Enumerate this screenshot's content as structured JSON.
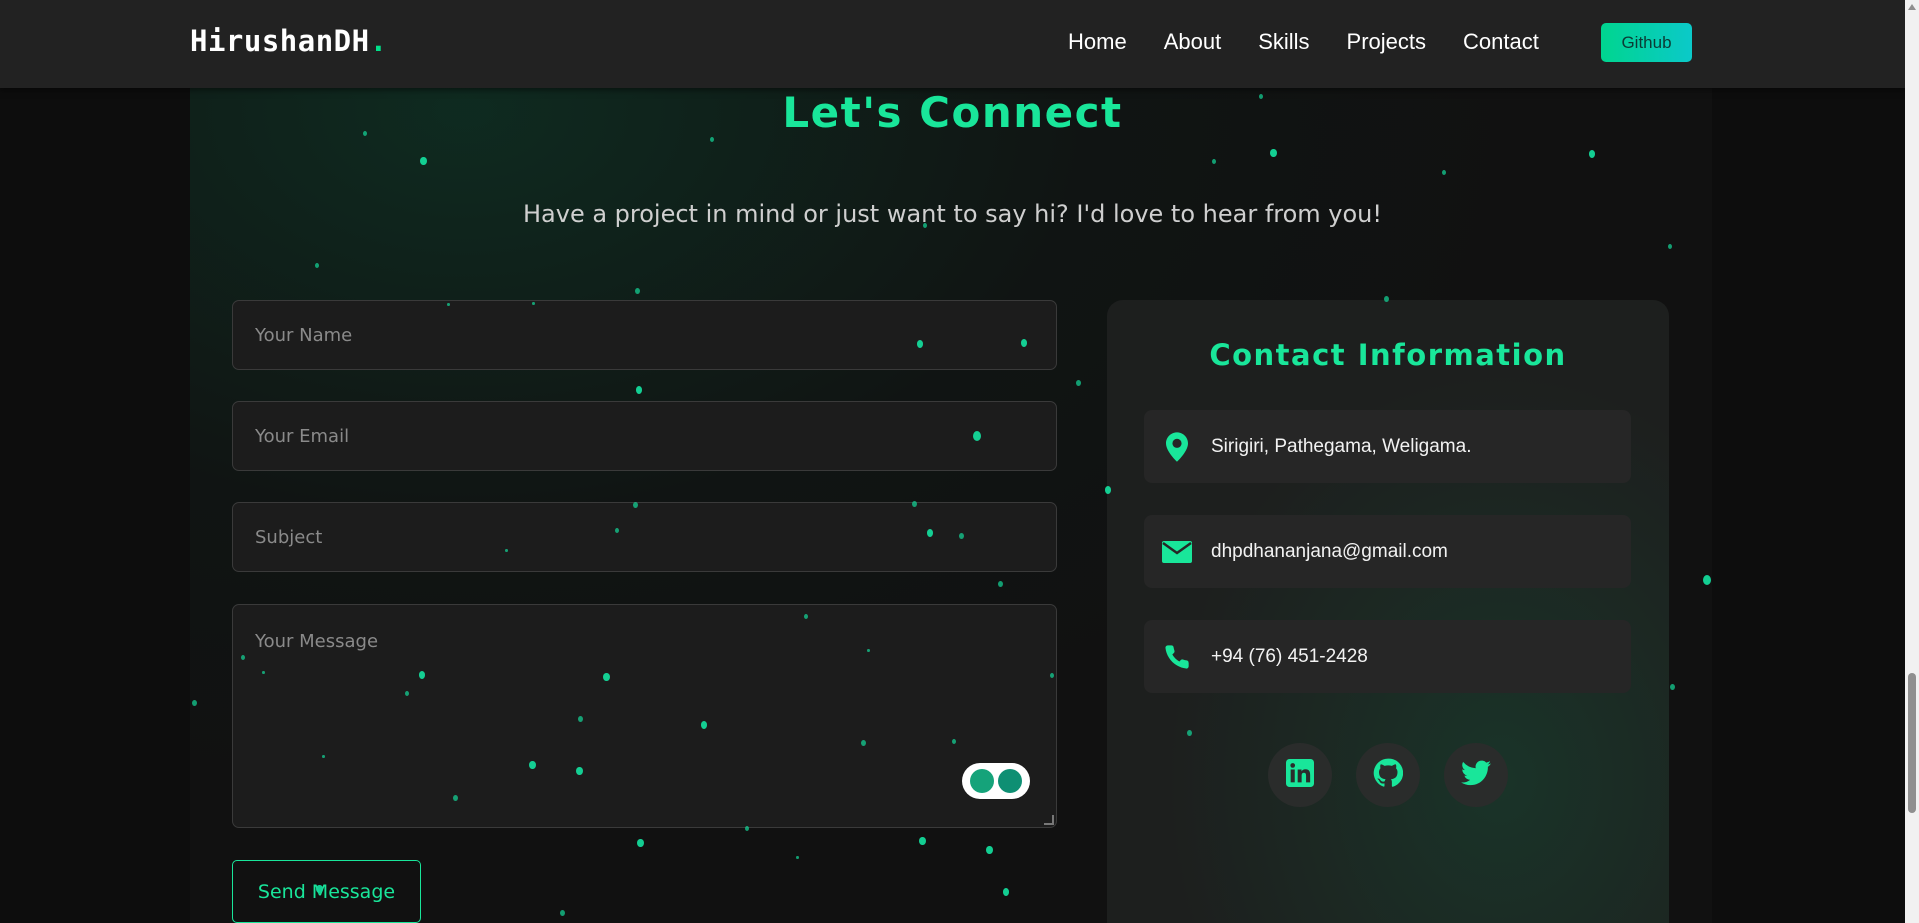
{
  "navbar": {
    "logo_text": "HirushanDH",
    "logo_dot": ".",
    "links": [
      "Home",
      "About",
      "Skills",
      "Projects",
      "Contact"
    ],
    "github_label": "Github"
  },
  "section": {
    "title": "Let's Connect",
    "subtitle": "Have a project in mind or just want to say hi? I'd love to hear from you!"
  },
  "form": {
    "name_placeholder": "Your Name",
    "email_placeholder": "Your Email",
    "subject_placeholder": "Subject",
    "message_placeholder": "Your Message",
    "send_label": "Send Message"
  },
  "contact": {
    "title": "Contact Information",
    "location": "Sirigiri, Pathegama, Weligama.",
    "email": "dhpdhananjana@gmail.com",
    "phone": "+94 (76) 451-2428",
    "socials": [
      "linkedin-icon",
      "github-icon",
      "twitter-icon"
    ]
  },
  "colors": {
    "accent": "#19e69a",
    "background": "#0d0d0d",
    "navbar": "#222222",
    "card": "#1d1f1e"
  }
}
